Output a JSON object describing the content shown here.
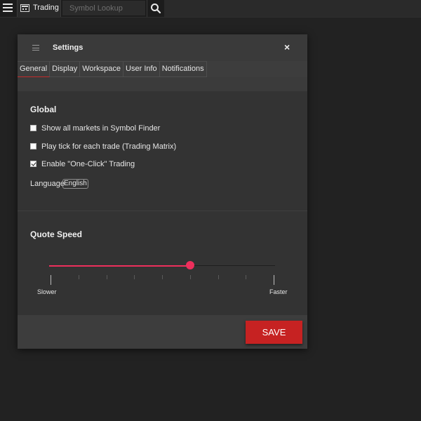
{
  "topbar": {
    "app_label": "Trading",
    "symbol_placeholder": "Symbol Lookup"
  },
  "dialog": {
    "title": "Settings",
    "close_glyph": "×",
    "tabs": [
      {
        "label": "General",
        "active": true
      },
      {
        "label": "Display",
        "active": false
      },
      {
        "label": "Workspace",
        "active": false
      },
      {
        "label": "User Info",
        "active": false
      },
      {
        "label": "Notifications",
        "active": false
      }
    ],
    "global": {
      "heading": "Global",
      "options": [
        {
          "label": "Show all markets in Symbol Finder",
          "checked": false
        },
        {
          "label": "Play tick for each trade (Trading Matrix)",
          "checked": false
        },
        {
          "label": "Enable \"One-Click\" Trading",
          "checked": true
        }
      ],
      "language_label": "Language",
      "language_value": "English"
    },
    "quote_speed": {
      "heading": "Quote Speed",
      "min_label": "Slower",
      "max_label": "Faster",
      "steps": 9,
      "value_fraction": 0.625
    },
    "save_label": "SAVE"
  },
  "colors": {
    "accent": "#c62222",
    "slider": "#ee2f5c",
    "background": "#222222",
    "dialog_bg": "#3d3d3d"
  },
  "icons": [
    "menu-icon",
    "trading-icon",
    "search-icon",
    "close-icon",
    "dialog-menu-icon"
  ]
}
